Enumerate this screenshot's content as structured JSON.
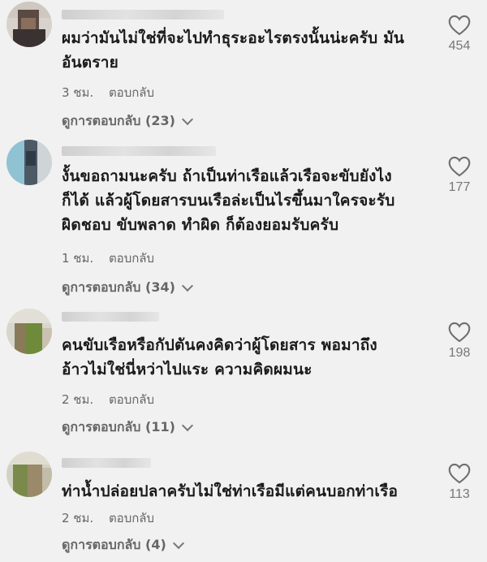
{
  "comments": [
    {
      "text_line1": "ผมว่ามันไม่ใช่ที่จะไปทำธุระอะไรตรงนั้นน่ะครับ มัน",
      "text_line2": "อันตราย",
      "text_line3": "",
      "time": "3 ชม.",
      "reply_label": "ตอบกลับ",
      "view_replies": "ดูการตอบกลับ (23)",
      "likes": "454"
    },
    {
      "text_line1": "งั้นขอถามนะครับ ถ้าเป็นท่าเรือแล้วเรือจะขับยังไง",
      "text_line2": "ก็ได้ แล้วผู้โดยสารบนเรือล่ะเป็นไรขึ้นมาใครจะรับ",
      "text_line3": "ผิดชอบ ขับพลาด ทำผิด ก็ต้องยอมรับครับ",
      "time": "1 ชม.",
      "reply_label": "ตอบกลับ",
      "view_replies": "ดูการตอบกลับ (34)",
      "likes": "177"
    },
    {
      "text_line1": "คนขับเรือหรือกัปตันคงคิดว่าผู้โดยสาร พอมาถึง",
      "text_line2": "อ้าวไม่ใช่นี่หว่าไปแระ ความคิดผมนะ",
      "text_line3": "",
      "time": "2 ชม.",
      "reply_label": "ตอบกลับ",
      "view_replies": "ดูการตอบกลับ (11)",
      "likes": "198"
    },
    {
      "text_line1": "ท่าน้ำปล่อยปลาครับไม่ใช่ท่าเรือมีแต่คนบอกท่าเรือ",
      "text_line2": "",
      "text_line3": "",
      "time": "2 ชม.",
      "reply_label": "ตอบกลับ",
      "view_replies": "ดูการตอบกลับ (4)",
      "likes": "113"
    }
  ]
}
